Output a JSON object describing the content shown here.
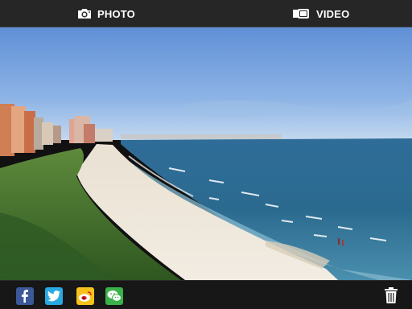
{
  "topbar": {
    "photo_tab": {
      "label": "PHOTO",
      "icon": "camera-icon"
    },
    "video_tab": {
      "label": "VIDEO",
      "icon": "video-camera-icon"
    }
  },
  "photo": {
    "subject": "beach"
  },
  "share_bar": {
    "buttons": [
      {
        "icon": "facebook-icon",
        "color": "#3b5998"
      },
      {
        "icon": "twitter-icon",
        "color": "#29a9e1"
      },
      {
        "icon": "weibo-icon",
        "color": "#f5c21b"
      },
      {
        "icon": "wechat-icon",
        "color": "#3bb14a"
      }
    ],
    "delete_icon": "trash-icon"
  }
}
